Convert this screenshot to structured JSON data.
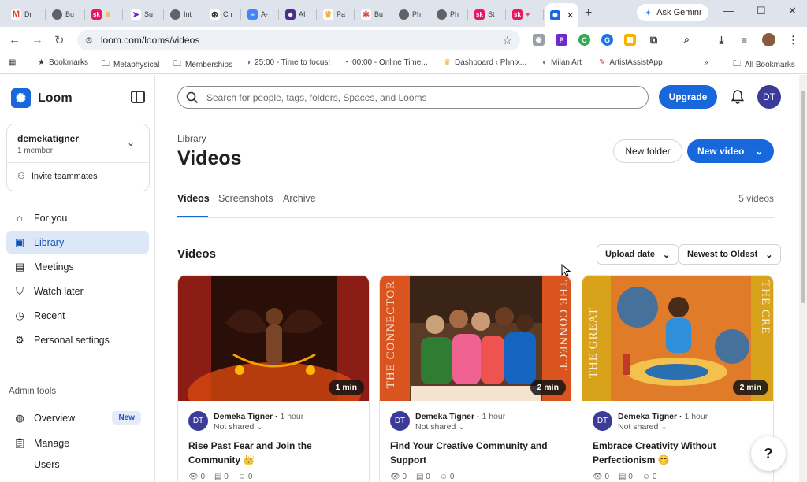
{
  "browser": {
    "tabs": [
      {
        "label": "Dr",
        "favicon": "gmail-icon",
        "color": "#ea4335"
      },
      {
        "label": "Bu",
        "favicon": "globe-icon",
        "color": "#5f6368"
      },
      {
        "label": "",
        "favicon": "sk-icon",
        "color": "#e8175d"
      },
      {
        "label": "Su",
        "favicon": "arrow-icon",
        "color": "#6b2ad0"
      },
      {
        "label": "Int",
        "favicon": "globe-icon",
        "color": "#5f6368"
      },
      {
        "label": "Ch",
        "favicon": "openai-icon",
        "color": "#333333"
      },
      {
        "label": "A-",
        "favicon": "docs-icon",
        "color": "#4285f4"
      },
      {
        "label": "AI",
        "favicon": "ai-icon",
        "color": "#4b2d8f"
      },
      {
        "label": "Pa",
        "favicon": "crown-icon",
        "color": "#f2b03d"
      },
      {
        "label": "Bu",
        "favicon": "asterisk-icon",
        "color": "#d9534f"
      },
      {
        "label": "Ph",
        "favicon": "globe-icon",
        "color": "#5f6368"
      },
      {
        "label": "Ph",
        "favicon": "globe-icon",
        "color": "#5f6368"
      },
      {
        "label": "St",
        "favicon": "sk-icon",
        "color": "#e8175d"
      },
      {
        "label": "",
        "favicon": "sk-icon",
        "color": "#e8175d"
      },
      {
        "label": "",
        "favicon": "loom-icon",
        "color": "#1868db"
      }
    ],
    "gemini_label": "Ask Gemini",
    "url": "loom.com/looms/videos"
  },
  "bookmarks": [
    {
      "label": "Bookmarks",
      "icon": "star-icon"
    },
    {
      "label": "Metaphysical",
      "icon": "folder-icon"
    },
    {
      "label": "Memberships",
      "icon": "folder-icon"
    },
    {
      "label": "25:00 - Time to focus!",
      "icon": "timer-icon"
    },
    {
      "label": "00:00 - Online Time...",
      "icon": "clock-icon"
    },
    {
      "label": "Dashboard ‹ Phnix...",
      "icon": "crown-icon"
    },
    {
      "label": "Milan Art",
      "icon": "milan-icon"
    },
    {
      "label": "ArtistAssistApp",
      "icon": "artist-icon"
    }
  ],
  "bookmarks_more": "»",
  "all_bookmarks": "All Bookmarks",
  "sidebar": {
    "brand": "Loom",
    "workspace_name": "demekatigner",
    "workspace_members": "1 member",
    "invite_label": "Invite teammates",
    "nav": [
      {
        "label": "For you",
        "icon": "home-icon"
      },
      {
        "label": "Library",
        "icon": "library-icon"
      },
      {
        "label": "Meetings",
        "icon": "calendar-icon"
      },
      {
        "label": "Watch later",
        "icon": "bookmark-icon"
      },
      {
        "label": "Recent",
        "icon": "clock-icon"
      },
      {
        "label": "Personal settings",
        "icon": "gear-icon"
      }
    ],
    "admin_label": "Admin tools",
    "overview_label": "Overview",
    "new_badge": "New",
    "manage_label": "Manage",
    "users_label": "Users"
  },
  "header": {
    "search_placeholder": "Search for people, tags, folders, Spaces, and Looms",
    "upgrade_label": "Upgrade",
    "avatar_initials": "DT"
  },
  "main": {
    "breadcrumb": "Library",
    "title": "Videos",
    "new_folder_label": "New folder",
    "new_video_label": "New video",
    "tabs": [
      {
        "label": "Videos"
      },
      {
        "label": "Screenshots"
      },
      {
        "label": "Archive"
      }
    ],
    "video_count": "5 videos",
    "section_title": "Videos",
    "sort_filter": "Upload date",
    "sort_order": "Newest to Oldest"
  },
  "cards": [
    {
      "duration": "1 min",
      "author": "Demeka Tigner",
      "time": "1 hour",
      "share": "Not shared",
      "title": "Rise Past Fear and Join the Community 👑",
      "views": "0",
      "comments": "0",
      "reactions": "0"
    },
    {
      "duration": "2 min",
      "author": "Demeka Tigner",
      "time": "1 hour",
      "share": "Not shared",
      "title": "Find Your Creative Community and Support",
      "thumb_text_left": "THE CONNECTOR",
      "thumb_text_right": "THE CONNECT",
      "views": "0",
      "comments": "0",
      "reactions": "0"
    },
    {
      "duration": "2 min",
      "author": "Demeka Tigner",
      "time": "1 hour",
      "share": "Not shared",
      "title": "Embrace Creativity Without Perfectionism 😊",
      "thumb_text_left": "THE GREAT",
      "thumb_text_right": "THE CRE",
      "views": "0",
      "comments": "0",
      "reactions": "0"
    }
  ],
  "help_label": "?",
  "colors": {
    "accent": "#1868db",
    "active_nav_bg": "#dce7f7",
    "avatar": "#3b3b9a"
  }
}
